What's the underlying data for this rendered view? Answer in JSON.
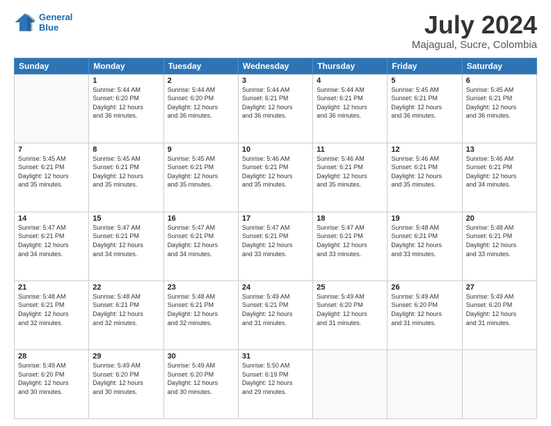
{
  "logo": {
    "line1": "General",
    "line2": "Blue"
  },
  "title": "July 2024",
  "subtitle": "Majagual, Sucre, Colombia",
  "headers": [
    "Sunday",
    "Monday",
    "Tuesday",
    "Wednesday",
    "Thursday",
    "Friday",
    "Saturday"
  ],
  "weeks": [
    [
      {
        "day": "",
        "sunrise": "",
        "sunset": "",
        "daylight": ""
      },
      {
        "day": "1",
        "sunrise": "Sunrise: 5:44 AM",
        "sunset": "Sunset: 6:20 PM",
        "daylight": "Daylight: 12 hours",
        "daylight2": "and 36 minutes."
      },
      {
        "day": "2",
        "sunrise": "Sunrise: 5:44 AM",
        "sunset": "Sunset: 6:20 PM",
        "daylight": "Daylight: 12 hours",
        "daylight2": "and 36 minutes."
      },
      {
        "day": "3",
        "sunrise": "Sunrise: 5:44 AM",
        "sunset": "Sunset: 6:21 PM",
        "daylight": "Daylight: 12 hours",
        "daylight2": "and 36 minutes."
      },
      {
        "day": "4",
        "sunrise": "Sunrise: 5:44 AM",
        "sunset": "Sunset: 6:21 PM",
        "daylight": "Daylight: 12 hours",
        "daylight2": "and 36 minutes."
      },
      {
        "day": "5",
        "sunrise": "Sunrise: 5:45 AM",
        "sunset": "Sunset: 6:21 PM",
        "daylight": "Daylight: 12 hours",
        "daylight2": "and 36 minutes."
      },
      {
        "day": "6",
        "sunrise": "Sunrise: 5:45 AM",
        "sunset": "Sunset: 6:21 PM",
        "daylight": "Daylight: 12 hours",
        "daylight2": "and 36 minutes."
      }
    ],
    [
      {
        "day": "7",
        "sunrise": "Sunrise: 5:45 AM",
        "sunset": "Sunset: 6:21 PM",
        "daylight": "Daylight: 12 hours",
        "daylight2": "and 35 minutes."
      },
      {
        "day": "8",
        "sunrise": "Sunrise: 5:45 AM",
        "sunset": "Sunset: 6:21 PM",
        "daylight": "Daylight: 12 hours",
        "daylight2": "and 35 minutes."
      },
      {
        "day": "9",
        "sunrise": "Sunrise: 5:45 AM",
        "sunset": "Sunset: 6:21 PM",
        "daylight": "Daylight: 12 hours",
        "daylight2": "and 35 minutes."
      },
      {
        "day": "10",
        "sunrise": "Sunrise: 5:46 AM",
        "sunset": "Sunset: 6:21 PM",
        "daylight": "Daylight: 12 hours",
        "daylight2": "and 35 minutes."
      },
      {
        "day": "11",
        "sunrise": "Sunrise: 5:46 AM",
        "sunset": "Sunset: 6:21 PM",
        "daylight": "Daylight: 12 hours",
        "daylight2": "and 35 minutes."
      },
      {
        "day": "12",
        "sunrise": "Sunrise: 5:46 AM",
        "sunset": "Sunset: 6:21 PM",
        "daylight": "Daylight: 12 hours",
        "daylight2": "and 35 minutes."
      },
      {
        "day": "13",
        "sunrise": "Sunrise: 5:46 AM",
        "sunset": "Sunset: 6:21 PM",
        "daylight": "Daylight: 12 hours",
        "daylight2": "and 34 minutes."
      }
    ],
    [
      {
        "day": "14",
        "sunrise": "Sunrise: 5:47 AM",
        "sunset": "Sunset: 6:21 PM",
        "daylight": "Daylight: 12 hours",
        "daylight2": "and 34 minutes."
      },
      {
        "day": "15",
        "sunrise": "Sunrise: 5:47 AM",
        "sunset": "Sunset: 6:21 PM",
        "daylight": "Daylight: 12 hours",
        "daylight2": "and 34 minutes."
      },
      {
        "day": "16",
        "sunrise": "Sunrise: 5:47 AM",
        "sunset": "Sunset: 6:21 PM",
        "daylight": "Daylight: 12 hours",
        "daylight2": "and 34 minutes."
      },
      {
        "day": "17",
        "sunrise": "Sunrise: 5:47 AM",
        "sunset": "Sunset: 6:21 PM",
        "daylight": "Daylight: 12 hours",
        "daylight2": "and 33 minutes."
      },
      {
        "day": "18",
        "sunrise": "Sunrise: 5:47 AM",
        "sunset": "Sunset: 6:21 PM",
        "daylight": "Daylight: 12 hours",
        "daylight2": "and 33 minutes."
      },
      {
        "day": "19",
        "sunrise": "Sunrise: 5:48 AM",
        "sunset": "Sunset: 6:21 PM",
        "daylight": "Daylight: 12 hours",
        "daylight2": "and 33 minutes."
      },
      {
        "day": "20",
        "sunrise": "Sunrise: 5:48 AM",
        "sunset": "Sunset: 6:21 PM",
        "daylight": "Daylight: 12 hours",
        "daylight2": "and 33 minutes."
      }
    ],
    [
      {
        "day": "21",
        "sunrise": "Sunrise: 5:48 AM",
        "sunset": "Sunset: 6:21 PM",
        "daylight": "Daylight: 12 hours",
        "daylight2": "and 32 minutes."
      },
      {
        "day": "22",
        "sunrise": "Sunrise: 5:48 AM",
        "sunset": "Sunset: 6:21 PM",
        "daylight": "Daylight: 12 hours",
        "daylight2": "and 32 minutes."
      },
      {
        "day": "23",
        "sunrise": "Sunrise: 5:48 AM",
        "sunset": "Sunset: 6:21 PM",
        "daylight": "Daylight: 12 hours",
        "daylight2": "and 32 minutes."
      },
      {
        "day": "24",
        "sunrise": "Sunrise: 5:49 AM",
        "sunset": "Sunset: 6:21 PM",
        "daylight": "Daylight: 12 hours",
        "daylight2": "and 31 minutes."
      },
      {
        "day": "25",
        "sunrise": "Sunrise: 5:49 AM",
        "sunset": "Sunset: 6:20 PM",
        "daylight": "Daylight: 12 hours",
        "daylight2": "and 31 minutes."
      },
      {
        "day": "26",
        "sunrise": "Sunrise: 5:49 AM",
        "sunset": "Sunset: 6:20 PM",
        "daylight": "Daylight: 12 hours",
        "daylight2": "and 31 minutes."
      },
      {
        "day": "27",
        "sunrise": "Sunrise: 5:49 AM",
        "sunset": "Sunset: 6:20 PM",
        "daylight": "Daylight: 12 hours",
        "daylight2": "and 31 minutes."
      }
    ],
    [
      {
        "day": "28",
        "sunrise": "Sunrise: 5:49 AM",
        "sunset": "Sunset: 6:20 PM",
        "daylight": "Daylight: 12 hours",
        "daylight2": "and 30 minutes."
      },
      {
        "day": "29",
        "sunrise": "Sunrise: 5:49 AM",
        "sunset": "Sunset: 6:20 PM",
        "daylight": "Daylight: 12 hours",
        "daylight2": "and 30 minutes."
      },
      {
        "day": "30",
        "sunrise": "Sunrise: 5:49 AM",
        "sunset": "Sunset: 6:20 PM",
        "daylight": "Daylight: 12 hours",
        "daylight2": "and 30 minutes."
      },
      {
        "day": "31",
        "sunrise": "Sunrise: 5:50 AM",
        "sunset": "Sunset: 6:19 PM",
        "daylight": "Daylight: 12 hours",
        "daylight2": "and 29 minutes."
      },
      {
        "day": "",
        "sunrise": "",
        "sunset": "",
        "daylight": ""
      },
      {
        "day": "",
        "sunrise": "",
        "sunset": "",
        "daylight": ""
      },
      {
        "day": "",
        "sunrise": "",
        "sunset": "",
        "daylight": ""
      }
    ]
  ]
}
